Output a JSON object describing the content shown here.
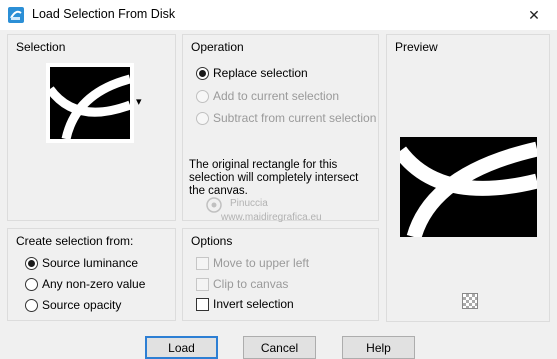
{
  "window": {
    "title": "Load Selection From Disk",
    "title_icon": "selection-app-icon",
    "close_glyph": "✕"
  },
  "selection": {
    "label": "Selection",
    "dropdown_glyph": "▾"
  },
  "operation": {
    "label": "Operation",
    "options": [
      "Replace selection",
      "Add to current selection",
      "Subtract from current selection"
    ],
    "selected_index": 0,
    "description": "The original rectangle for this selection will completely intersect the canvas."
  },
  "preview": {
    "label": "Preview",
    "toggle_icon": "checkerboard-icon"
  },
  "create_from": {
    "label": "Create selection from:",
    "options": [
      "Source luminance",
      "Any non-zero value",
      "Source opacity"
    ],
    "selected_index": 0
  },
  "options_group": {
    "label": "Options",
    "move_upper_left": "Move to upper left",
    "clip_canvas": "Clip to canvas",
    "invert": "Invert selection"
  },
  "buttons": {
    "load": "Load",
    "cancel": "Cancel",
    "help": "Help"
  },
  "watermark": {
    "line1": "Pinuccia",
    "line2": "www.maidiregrafica.eu"
  },
  "colors": {
    "dialog_bg": "#f0f0f0",
    "group_border": "#dcdcdc",
    "button_bg": "#e1e1e1",
    "default_button_border": "#2d7fd4"
  }
}
